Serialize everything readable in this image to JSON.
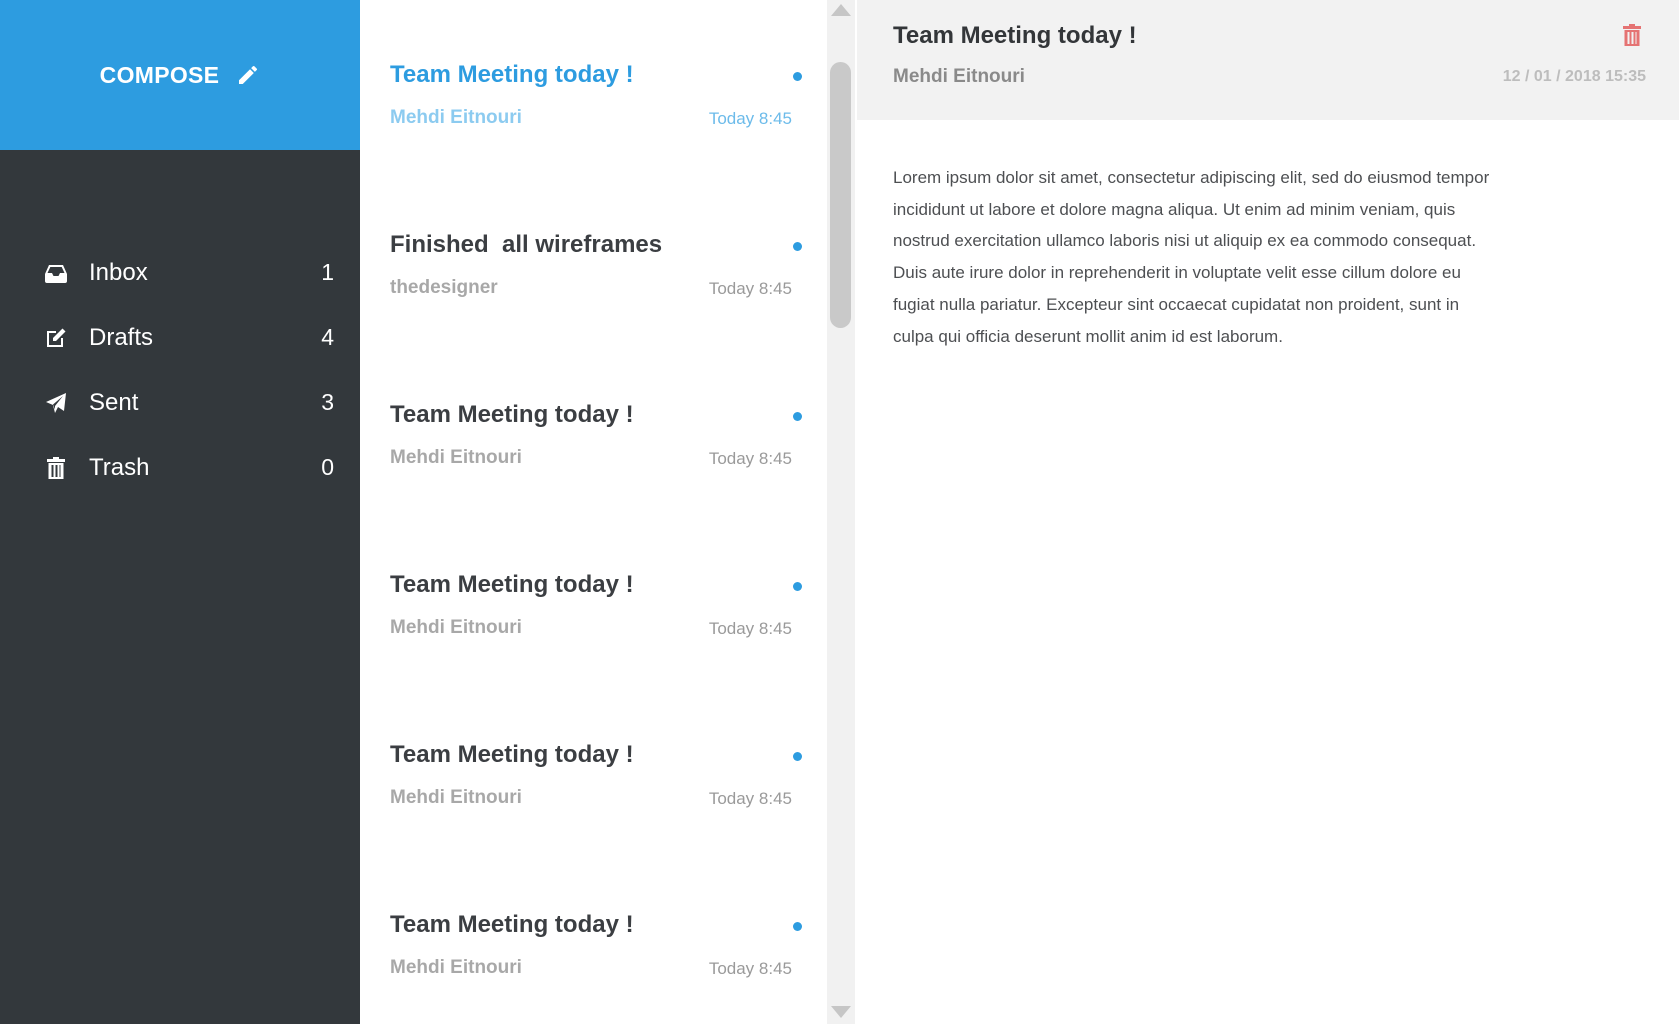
{
  "compose": {
    "label": "COMPOSE",
    "icon": "pencil-icon"
  },
  "nav": {
    "items": [
      {
        "label": "Inbox",
        "count": "1",
        "icon": "inbox-icon"
      },
      {
        "label": "Drafts",
        "count": "4",
        "icon": "edit-icon"
      },
      {
        "label": "Sent",
        "count": "3",
        "icon": "send-icon"
      },
      {
        "label": "Trash",
        "count": "0",
        "icon": "trash-icon"
      }
    ]
  },
  "emails": [
    {
      "subject": "Team Meeting today !",
      "sender": "Mehdi Eitnouri",
      "time": "Today 8:45",
      "unread": true,
      "active": true
    },
    {
      "subject": "Finished  all wireframes",
      "sender": "thedesigner",
      "time": "Today 8:45",
      "unread": true,
      "active": false
    },
    {
      "subject": "Team Meeting today !",
      "sender": "Mehdi Eitnouri",
      "time": "Today 8:45",
      "unread": true,
      "active": false
    },
    {
      "subject": "Team Meeting today !",
      "sender": "Mehdi Eitnouri",
      "time": "Today 8:45",
      "unread": true,
      "active": false
    },
    {
      "subject": "Team Meeting today !",
      "sender": "Mehdi Eitnouri",
      "time": "Today 8:45",
      "unread": true,
      "active": false
    },
    {
      "subject": "Team Meeting today !",
      "sender": "Mehdi Eitnouri",
      "time": "Today 8:45",
      "unread": true,
      "active": false
    }
  ],
  "reader": {
    "title": "Team Meeting today !",
    "sender": "Mehdi Eitnouri",
    "date": "12 / 01 / 2018 15:35",
    "body": "Lorem ipsum dolor sit amet, consectetur adipiscing elit, sed do eiusmod tempor incididunt ut labore et dolore magna aliqua. Ut enim ad minim veniam, quis nostrud exercitation ullamco laboris nisi ut aliquip ex ea commodo consequat. Duis aute irure dolor in reprehenderit in voluptate velit esse cillum dolore eu fugiat nulla pariatur. Excepteur sint occaecat cupidatat non proident, sunt in culpa qui officia deserunt mollit anim id est laborum.",
    "delete_icon": "trash-icon"
  },
  "colors": {
    "accent": "#2d9ce0",
    "sidebar": "#33383c",
    "delete": "#e57373"
  }
}
